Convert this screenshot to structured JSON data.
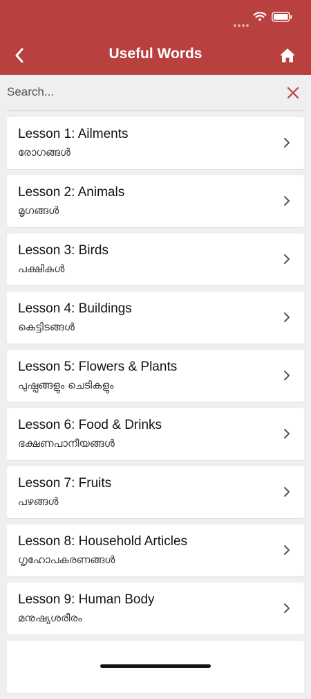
{
  "header": {
    "title": "Useful Words"
  },
  "search": {
    "placeholder": "Search...",
    "value": ""
  },
  "lessons": [
    {
      "title": "Lesson 1: Ailments",
      "subtitle": "രോഗങ്ങൾ"
    },
    {
      "title": "Lesson 2: Animals",
      "subtitle": "മൃഗങ്ങൾ"
    },
    {
      "title": "Lesson 3: Birds",
      "subtitle": "പക്ഷികൾ"
    },
    {
      "title": "Lesson 4: Buildings",
      "subtitle": "കെട്ടിടങ്ങൾ"
    },
    {
      "title": "Lesson 5: Flowers & Plants",
      "subtitle": "പുഷ്പങ്ങളും ചെടികളും"
    },
    {
      "title": "Lesson 6: Food & Drinks",
      "subtitle": "ഭക്ഷണപാനീയങ്ങൾ"
    },
    {
      "title": "Lesson 7: Fruits",
      "subtitle": "പഴങ്ങൾ"
    },
    {
      "title": "Lesson 8: Household Articles",
      "subtitle": "ഗൃഹോപകരണങ്ങൾ"
    },
    {
      "title": "Lesson 9: Human Body",
      "subtitle": "മനുഷ്യശരീരം"
    }
  ],
  "icons": {
    "back": "chevron-left-icon",
    "home": "home-icon",
    "clear": "close-icon",
    "row": "chevron-right-icon"
  },
  "colors": {
    "accent": "#b8403f",
    "background": "#efeff1",
    "clear_icon": "#b8403f"
  }
}
